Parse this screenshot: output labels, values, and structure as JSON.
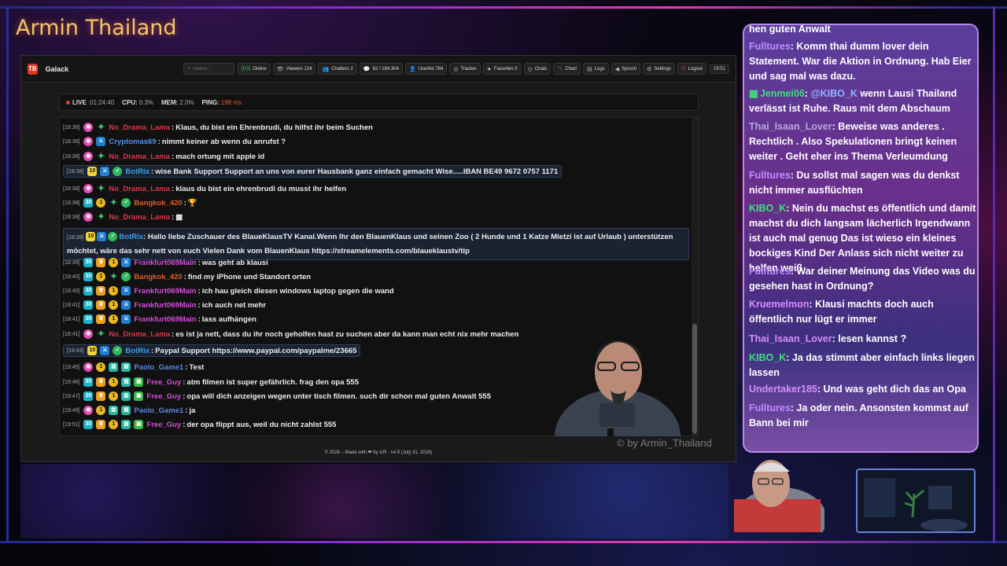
{
  "overlay": {
    "title": "Armin Thailand",
    "watermark": "© by Armin_Thailand"
  },
  "app": {
    "name": "Galack",
    "logo": "TB",
    "search_placeholder": "Search...",
    "toolbar": [
      {
        "id": "online",
        "icon": "online-icon",
        "label": "Online",
        "glyph": "((•))"
      },
      {
        "id": "viewers",
        "icon": "eye-icon",
        "label": "Viewers 124",
        "glyph": "👁"
      },
      {
        "id": "chatters",
        "icon": "users-icon",
        "label": "Chatters 2",
        "glyph": "👥"
      },
      {
        "id": "messages",
        "icon": "chat-icon",
        "label": "62 / 184.304",
        "glyph": "💬"
      },
      {
        "id": "userlist",
        "icon": "user-icon",
        "label": "Userlist 784",
        "glyph": "👤"
      },
      {
        "id": "tracker",
        "icon": "target-icon",
        "label": "Tracker",
        "glyph": "◎"
      },
      {
        "id": "favorites",
        "icon": "star-icon",
        "label": "Favorites 0",
        "glyph": "★"
      },
      {
        "id": "chats",
        "icon": "clock-icon",
        "label": "Chats",
        "glyph": "◷"
      },
      {
        "id": "chart",
        "icon": "chart-icon",
        "label": "Chart",
        "glyph": "〽"
      },
      {
        "id": "logs",
        "icon": "logs-icon",
        "label": "Logs",
        "glyph": "▤"
      },
      {
        "id": "spruch",
        "icon": "megaphone-icon",
        "label": "Spruch",
        "glyph": "◀"
      },
      {
        "id": "settings",
        "icon": "gear-icon",
        "label": "Settings",
        "glyph": "⚙"
      },
      {
        "id": "logout",
        "icon": "logout-icon",
        "label": "Logout",
        "glyph": "⏻"
      }
    ],
    "clock": "19:51",
    "status": {
      "live_label": "LIVE",
      "live_time": "01:24:40",
      "cpu_label": "CPU:",
      "cpu_value": "0.3%",
      "mem_label": "MEM:",
      "mem_value": "2.0%",
      "ping_label": "PING:",
      "ping_value": "198 ms"
    },
    "footer": "© 2026 – Made with ❤ by tcR · v4.9 (July 31, 2026)"
  },
  "chat": [
    {
      "time": "[18:36]",
      "badges": [
        "vip",
        "gem"
      ],
      "user": "No_Drama_Lama",
      "color": "red",
      "text": "Klaus, du bist ein Ehrenbrudi, du hilfst ihr beim Suchen"
    },
    {
      "time": "[18:36]",
      "badges": [
        "vip",
        "sword"
      ],
      "user": "Cryptomas69",
      "color": "blue",
      "text": "nimmt keiner ab wenn du anrufst ?"
    },
    {
      "time": "[18:38]",
      "badges": [
        "vip",
        "gem"
      ],
      "user": "No_Drama_Lama",
      "color": "red",
      "text": "mach ortung mit apple id"
    },
    {
      "time": "[18:38]",
      "badges": [
        "ten",
        "sword",
        "check"
      ],
      "user": "BotRix",
      "color": "bot",
      "text": "wise Bank Support Support an uns von eurer Hausbank ganz einfach gemacht Wise.....IBAN BE49 9672 0757 1171",
      "hl": true
    },
    {
      "time": "[18:38]",
      "badges": [
        "vip",
        "gem"
      ],
      "user": "No_Drama_Lama",
      "color": "red",
      "text": "klaus du bist ein ehrenbrudi du musst ihr helfen"
    },
    {
      "time": "[18:38]",
      "badges": [
        "30",
        "coin",
        "gem",
        "check"
      ],
      "user": "Bangkok_420",
      "color": "orange",
      "text": "🏆"
    },
    {
      "time": "[18:38]",
      "badges": [
        "vip",
        "gem"
      ],
      "user": "No_Drama_Lama",
      "color": "red",
      "text": "▦"
    },
    {
      "time": "[18:39]",
      "badges": [
        "ten",
        "sword",
        "check"
      ],
      "user": "BotRix",
      "color": "bot",
      "text": "Hallo liebe Zuschauer des BlaueKlausTV Kanal.Wenn Ihr den BlauenKlaus und seinen Zoo ( 2 Hunde und 1 Katze Mietzi ist auf Urlaub ) unterstützen möchtet, wäre das sehr nett von euch Vielen Dank vom BlauenKlaus https://streamelements.com/blaueklaustv/tip",
      "hl2": true
    },
    {
      "time": "[18:39]",
      "badges": [
        "30",
        "crown",
        "coin",
        "sword"
      ],
      "user": "Frankfurt069Main",
      "color": "mag",
      "text": "was geht ab klausi"
    },
    {
      "time": "[18:40]",
      "badges": [
        "30",
        "coin",
        "gem",
        "check"
      ],
      "user": "Bangkok_420",
      "color": "orange",
      "text": "find my iPhone und Standort orten"
    },
    {
      "time": "[18:40]",
      "badges": [
        "30",
        "crown",
        "coin",
        "sword"
      ],
      "user": "Frankfurt069Main",
      "color": "mag",
      "text": "ich hau gleich diesen windows laptop gegen die wand"
    },
    {
      "time": "[18:41]",
      "badges": [
        "30",
        "crown",
        "coin",
        "sword"
      ],
      "user": "Frankfurt069Main",
      "color": "mag",
      "text": "ich auch net mehr"
    },
    {
      "time": "[18:41]",
      "badges": [
        "30",
        "crown",
        "coin",
        "sword"
      ],
      "user": "Frankfurt069Main",
      "color": "mag",
      "text": "lass aufhängen"
    },
    {
      "time": "[18:41]",
      "badges": [
        "vip",
        "gem"
      ],
      "user": "No_Drama_Lama",
      "color": "red",
      "text": "es ist ja nett, dass du ihr noch geholfen hast zu suchen aber da kann man echt nix mehr machen"
    },
    {
      "time": "[19:43]",
      "badges": [
        "ten",
        "sword",
        "check"
      ],
      "user": "BotRix",
      "color": "bot",
      "text": "Paypal Support https://www.paypal.com/paypalme/23665",
      "hl": true
    },
    {
      "time": "[19:45]",
      "badges": [
        "vip",
        "coin",
        "bars",
        "bars"
      ],
      "user": "Paolo_Game1",
      "color": "paolo",
      "text": "Test"
    },
    {
      "time": "[19:46]",
      "badges": [
        "30",
        "crown",
        "coin",
        "bars",
        "gift"
      ],
      "user": "Free_Guy",
      "color": "mag",
      "text": "atm filmen ist super gefährlich. frag den opa 555"
    },
    {
      "time": "[19:47]",
      "badges": [
        "30",
        "crown",
        "coin",
        "bars",
        "gift"
      ],
      "user": "Free_Guy",
      "color": "mag",
      "text": "opa will dich anzeigen wegen unter tisch filmen. such dir schon mal guten Anwalt 555"
    },
    {
      "time": "[19:49]",
      "badges": [
        "vip",
        "coin",
        "bars",
        "bars"
      ],
      "user": "Paolo_Game1",
      "color": "paolo",
      "text": "ja"
    },
    {
      "time": "[19:51]",
      "badges": [
        "30",
        "crown",
        "coin",
        "bars",
        "gift"
      ],
      "user": "Free_Guy",
      "color": "mag",
      "text": "der opa flippt aus, weil du nicht zahlst 555"
    }
  ],
  "side_chat": [
    {
      "user": "",
      "text": "hen guten Anwalt"
    },
    {
      "user": "Fulltures",
      "color": "purple",
      "text": ": Komm thai dumm lover dein Statement. War die Aktion in Ordnung. Hab Eier und sag mal was dazu."
    },
    {
      "user": "Jenmei06",
      "color": "green",
      "badge": "▦",
      "text": ": @KIBO_K wenn Lausi Thailand verlässt ist Ruhe. Raus mit dem Abschaum",
      "mention": "@KIBO_K"
    },
    {
      "user": "Thai_Isaan_Lover",
      "color": "gray",
      "text": ": Beweise was anderes . Rechtlich . Also Spekulationen bringt keinen weiter . Geht eher ins Thema Verleumdung"
    },
    {
      "user": "Fulltures",
      "color": "purple",
      "text": ": Du sollst mal sagen was du denkst nicht immer ausflüchten"
    },
    {
      "user": "KIBO_K",
      "color": "green",
      "text": ": Nein du machst es öffentlich und damit machst du dich langsam lächerlich Irgendwann ist auch mal genug Das ist wieso ein kleines bockiges Kind Der Anlass sich nicht weiter zu helfen weiß"
    },
    {
      "user": "Fulltures",
      "color": "purple",
      "text": ": War deiner Meinung das Video was du gesehen hast in Ordnung?"
    },
    {
      "user": "Kruemelmon",
      "color": "pink",
      "text": ": Klausi machts doch auch öffentlich nur lügt er immer"
    },
    {
      "user": "Thai_Isaan_Lover",
      "color": "pink",
      "text": ": lesen kannst ?"
    },
    {
      "user": "KIBO_K",
      "color": "green",
      "text": ": Ja das stimmt aber einfach links liegen lassen"
    },
    {
      "user": "Undertaker185",
      "color": "pink",
      "text": ": Und was geht dich das an Opa"
    },
    {
      "user": "Fulltures",
      "color": "purple",
      "text": ": Ja oder nein. Ansonsten kommst auf Bann bei mir"
    }
  ]
}
